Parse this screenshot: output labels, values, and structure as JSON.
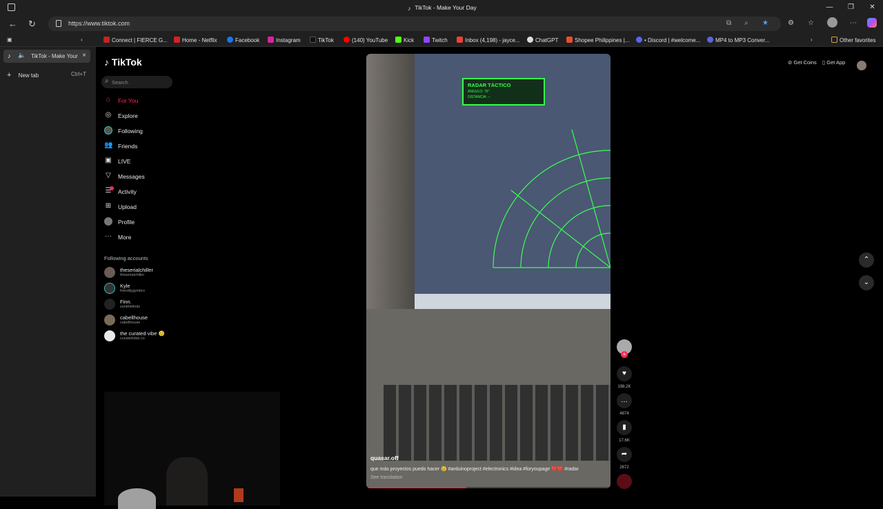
{
  "window": {
    "title": "TikTok - Make Your Day",
    "min": "—",
    "max": "❐",
    "close": "✕"
  },
  "address": {
    "url": "https://www.tiktok.com"
  },
  "bookmarks": [
    {
      "label": "Connect | FIERCE G...",
      "color": "#c02525"
    },
    {
      "label": "Home - Netflix",
      "color": "#d81f26"
    },
    {
      "label": "Facebook",
      "color": "#1877f2"
    },
    {
      "label": "Instagram",
      "color": "#d6249f"
    },
    {
      "label": "TikTok",
      "color": "#111111"
    },
    {
      "label": "(140) YouTube",
      "color": "#ff0000"
    },
    {
      "label": "Kick",
      "color": "#53fc18"
    },
    {
      "label": "Twitch",
      "color": "#9146ff"
    },
    {
      "label": "Inbox (4,198) - jayce...",
      "color": "#ea4335"
    },
    {
      "label": "ChatGPT",
      "color": "#dddddd"
    },
    {
      "label": "Shopee Philippines |...",
      "color": "#ee4d2d"
    },
    {
      "label": "• Discord | #welcome...",
      "color": "#5865f2"
    },
    {
      "label": "MP4 to MP3 Conver...",
      "color": "#5a67d8"
    },
    {
      "label": "Other favorites",
      "color": "#cfa640"
    }
  ],
  "tabs": {
    "active_title": "TikTok - Make Your Day",
    "new_tab": "New tab",
    "new_tab_key": "Ctrl+T"
  },
  "tiktok": {
    "logo": "TikTok",
    "search_placeholder": "Search",
    "nav": [
      "For You",
      "Explore",
      "Following",
      "Friends",
      "LIVE",
      "Messages",
      "Activity",
      "Upload",
      "Profile",
      "More"
    ],
    "following_header": "Following accounts",
    "accounts": [
      {
        "name": "theserialchiller",
        "user": "theserialchiller"
      },
      {
        "name": "Kyle",
        "user": "friendlygymbro"
      },
      {
        "name": "Finn.",
        "user": "zenithkfinds"
      },
      {
        "name": "cabellhouse",
        "user": "cabellhouse"
      },
      {
        "name": "the curated vibe 😊",
        "user": "curatedvibe.co"
      }
    ],
    "get_coins": "Get Coins",
    "get_app": "Get App"
  },
  "video": {
    "radar_title": "RADAR TÁCTICO",
    "radar_angle": "ÁNGULO: 75°",
    "radar_distance": "DISTANCIA: --",
    "author": "quasar.off",
    "caption": "que más proyectos puedo hacer 😢 #arduinoproject #electronics #idea #foryoupage ❤️❤️ #radar",
    "see_translation": "See translation",
    "progress": 0.41,
    "likes": "198.2K",
    "comments": "4874",
    "saves": "17.6K",
    "shares": "2672"
  },
  "icons": {
    "heart": "heart-icon",
    "comment": "comment-icon",
    "bookmark": "bookmark-icon",
    "share": "share-icon"
  }
}
